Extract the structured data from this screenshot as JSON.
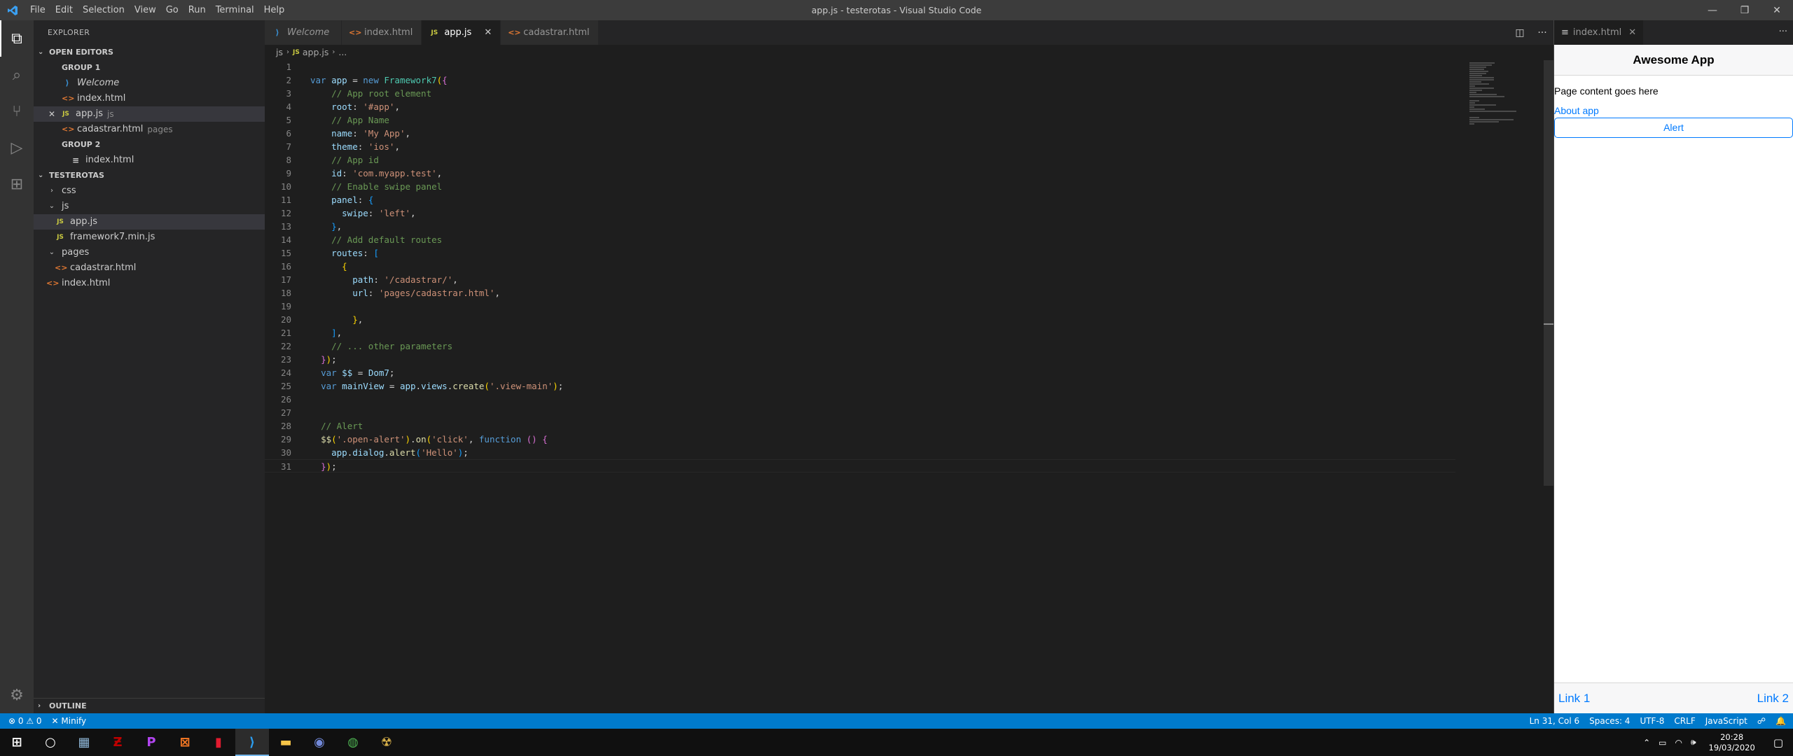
{
  "window": {
    "title": "app.js - testerotas - Visual Studio Code",
    "menu": [
      "File",
      "Edit",
      "Selection",
      "View",
      "Go",
      "Run",
      "Terminal",
      "Help"
    ],
    "controls": {
      "minimize": "—",
      "restore": "❐",
      "close": "✕"
    }
  },
  "activity_bar": {
    "items": [
      {
        "name": "explorer-icon",
        "glyph": "⧉"
      },
      {
        "name": "search-icon",
        "glyph": "⌕"
      },
      {
        "name": "source-control-icon",
        "glyph": "⑂"
      },
      {
        "name": "run-debug-icon",
        "glyph": "▷"
      },
      {
        "name": "extensions-icon",
        "glyph": "⊞"
      }
    ],
    "bottom": {
      "name": "manage-gear-icon",
      "glyph": "⚙"
    }
  },
  "sidebar": {
    "title": "EXPLORER",
    "open_editors": {
      "header": "OPEN EDITORS",
      "group1_label": "GROUP 1",
      "group1_items": [
        {
          "label": "Welcome",
          "icon": "vs",
          "icon_text": "⟩",
          "desc": "",
          "italic": true
        },
        {
          "label": "index.html",
          "icon": "html",
          "icon_text": "<>",
          "desc": ""
        },
        {
          "label": "app.js",
          "icon": "js",
          "icon_text": "JS",
          "desc": "js",
          "close": "✕"
        },
        {
          "label": "cadastrar.html",
          "icon": "html",
          "icon_text": "<>",
          "desc": "pages"
        }
      ],
      "group2_label": "GROUP 2",
      "group2_items": [
        {
          "label": "index.html",
          "icon": "preview",
          "icon_text": "≡",
          "desc": ""
        }
      ]
    },
    "project": {
      "header": "TESTEROTAS",
      "items": [
        {
          "label": "css",
          "type": "folder",
          "chev": "›",
          "depth": 1
        },
        {
          "label": "js",
          "type": "folder",
          "chev": "⌄",
          "depth": 1
        },
        {
          "label": "app.js",
          "type": "js",
          "depth": 2,
          "icon_text": "JS"
        },
        {
          "label": "framework7.min.js",
          "type": "js",
          "depth": 2,
          "icon_text": "JS"
        },
        {
          "label": "pages",
          "type": "folder",
          "chev": "⌄",
          "depth": 1
        },
        {
          "label": "cadastrar.html",
          "type": "html",
          "depth": 2,
          "icon_text": "<>"
        },
        {
          "label": "index.html",
          "type": "html",
          "depth": 1,
          "icon_text": "<>"
        }
      ]
    },
    "outline_header": "OUTLINE"
  },
  "editor": {
    "tabs": [
      {
        "label": "Welcome",
        "icon": "vs",
        "icon_text": "⟩",
        "italic": true,
        "active": false
      },
      {
        "label": "index.html",
        "icon": "html",
        "icon_text": "<>",
        "italic": false,
        "active": false
      },
      {
        "label": "app.js",
        "icon": "js",
        "icon_text": "JS",
        "italic": false,
        "active": true,
        "close": "✕"
      },
      {
        "label": "cadastrar.html",
        "icon": "html",
        "icon_text": "<>",
        "italic": false,
        "active": false
      }
    ],
    "tab_actions": {
      "split": "◫",
      "more": "···"
    },
    "breadcrumb": {
      "folder": "js",
      "file": "app.js",
      "symbol": "..."
    },
    "code_lines": [
      [],
      [
        [
          "kw",
          "var "
        ],
        [
          "var",
          "app"
        ],
        [
          "pl",
          " = "
        ],
        [
          "kw",
          "new "
        ],
        [
          "cls",
          "Framework7"
        ],
        [
          "br1",
          "("
        ],
        [
          "br2",
          "{"
        ]
      ],
      [
        [
          "pl",
          "    "
        ],
        [
          "com",
          "// App root element"
        ]
      ],
      [
        [
          "pl",
          "    "
        ],
        [
          "var",
          "root"
        ],
        [
          "pl",
          ": "
        ],
        [
          "str",
          "'#app'"
        ],
        [
          "pl",
          ","
        ]
      ],
      [
        [
          "pl",
          "    "
        ],
        [
          "com",
          "// App Name"
        ]
      ],
      [
        [
          "pl",
          "    "
        ],
        [
          "var",
          "name"
        ],
        [
          "pl",
          ": "
        ],
        [
          "str",
          "'My App'"
        ],
        [
          "pl",
          ","
        ]
      ],
      [
        [
          "pl",
          "    "
        ],
        [
          "var",
          "theme"
        ],
        [
          "pl",
          ": "
        ],
        [
          "str",
          "'ios'"
        ],
        [
          "pl",
          ","
        ]
      ],
      [
        [
          "pl",
          "    "
        ],
        [
          "com",
          "// App id"
        ]
      ],
      [
        [
          "pl",
          "    "
        ],
        [
          "var",
          "id"
        ],
        [
          "pl",
          ": "
        ],
        [
          "str",
          "'com.myapp.test'"
        ],
        [
          "pl",
          ","
        ]
      ],
      [
        [
          "pl",
          "    "
        ],
        [
          "com",
          "// Enable swipe panel"
        ]
      ],
      [
        [
          "pl",
          "    "
        ],
        [
          "var",
          "panel"
        ],
        [
          "pl",
          ": "
        ],
        [
          "br3",
          "{"
        ]
      ],
      [
        [
          "pl",
          "      "
        ],
        [
          "var",
          "swipe"
        ],
        [
          "pl",
          ": "
        ],
        [
          "str",
          "'left'"
        ],
        [
          "pl",
          ","
        ]
      ],
      [
        [
          "pl",
          "    "
        ],
        [
          "br3",
          "}"
        ],
        [
          "pl",
          ","
        ]
      ],
      [
        [
          "pl",
          "    "
        ],
        [
          "com",
          "// Add default routes"
        ]
      ],
      [
        [
          "pl",
          "    "
        ],
        [
          "var",
          "routes"
        ],
        [
          "pl",
          ": "
        ],
        [
          "br3",
          "["
        ]
      ],
      [
        [
          "pl",
          "      "
        ],
        [
          "br1",
          "{"
        ]
      ],
      [
        [
          "pl",
          "        "
        ],
        [
          "var",
          "path"
        ],
        [
          "pl",
          ": "
        ],
        [
          "str",
          "'/cadastrar/'"
        ],
        [
          "pl",
          ","
        ]
      ],
      [
        [
          "pl",
          "        "
        ],
        [
          "var",
          "url"
        ],
        [
          "pl",
          ": "
        ],
        [
          "str",
          "'pages/cadastrar.html'"
        ],
        [
          "pl",
          ","
        ]
      ],
      [],
      [
        [
          "pl",
          "        "
        ],
        [
          "br1",
          "}"
        ],
        [
          "pl",
          ","
        ]
      ],
      [
        [
          "pl",
          "    "
        ],
        [
          "br3",
          "]"
        ],
        [
          "pl",
          ","
        ]
      ],
      [
        [
          "pl",
          "    "
        ],
        [
          "com",
          "// ... other parameters"
        ]
      ],
      [
        [
          "pl",
          "  "
        ],
        [
          "br2",
          "}"
        ],
        [
          "br1",
          ")"
        ],
        [
          "pl",
          ";"
        ]
      ],
      [
        [
          "pl",
          "  "
        ],
        [
          "kw",
          "var "
        ],
        [
          "var",
          "$$"
        ],
        [
          "pl",
          " = "
        ],
        [
          "var",
          "Dom7"
        ],
        [
          "pl",
          ";"
        ]
      ],
      [
        [
          "pl",
          "  "
        ],
        [
          "kw",
          "var "
        ],
        [
          "var",
          "mainView"
        ],
        [
          "pl",
          " = "
        ],
        [
          "var",
          "app"
        ],
        [
          "pl",
          "."
        ],
        [
          "var",
          "views"
        ],
        [
          "pl",
          "."
        ],
        [
          "fn",
          "create"
        ],
        [
          "br1",
          "("
        ],
        [
          "str",
          "'.view-main'"
        ],
        [
          "br1",
          ")"
        ],
        [
          "pl",
          ";"
        ]
      ],
      [],
      [],
      [
        [
          "pl",
          "  "
        ],
        [
          "com",
          "// Alert"
        ]
      ],
      [
        [
          "pl",
          "  "
        ],
        [
          "fn",
          "$$"
        ],
        [
          "br1",
          "("
        ],
        [
          "str",
          "'.open-alert'"
        ],
        [
          "br1",
          ")"
        ],
        [
          "pl",
          "."
        ],
        [
          "fn",
          "on"
        ],
        [
          "br1",
          "("
        ],
        [
          "str",
          "'click'"
        ],
        [
          "pl",
          ", "
        ],
        [
          "kw",
          "function "
        ],
        [
          "br2",
          "()"
        ],
        [
          "pl",
          " "
        ],
        [
          "br2",
          "{"
        ]
      ],
      [
        [
          "pl",
          "    "
        ],
        [
          "var",
          "app"
        ],
        [
          "pl",
          "."
        ],
        [
          "var",
          "dialog"
        ],
        [
          "pl",
          "."
        ],
        [
          "fn",
          "alert"
        ],
        [
          "br3",
          "("
        ],
        [
          "str",
          "'Hello'"
        ],
        [
          "br3",
          ")"
        ],
        [
          "pl",
          ";"
        ]
      ],
      [
        [
          "pl",
          "  "
        ],
        [
          "br2",
          "}"
        ],
        [
          "br1",
          ")"
        ],
        [
          "pl",
          ";"
        ]
      ]
    ],
    "current_line": 31
  },
  "preview": {
    "tab": {
      "label": "index.html",
      "close": "✕"
    },
    "actions": {
      "more": "···"
    },
    "navbar_title": "Awesome App",
    "content_text": "Page content goes here",
    "link_about": "About app",
    "alert_button": "Alert",
    "toolbar": {
      "link1": "Link 1",
      "link2": "Link 2"
    }
  },
  "statusbar": {
    "problems": "⊗ 0 ⚠ 0",
    "minify": "✕ Minify",
    "position": "Ln 31, Col 6",
    "spaces": "Spaces: 4",
    "encoding": "UTF-8",
    "eol": "CRLF",
    "language": "JavaScript",
    "feedback": "☍",
    "bell": "🔔"
  },
  "taskbar": {
    "apps": [
      {
        "name": "windows-start-icon",
        "glyph": "⊞",
        "color": "#ffffff"
      },
      {
        "name": "cortana-search-icon",
        "glyph": "○",
        "color": "#ffffff"
      },
      {
        "name": "task-view-icon",
        "glyph": "▦",
        "color": "#8fb7d8"
      },
      {
        "name": "filezilla-icon",
        "glyph": "Ƶ",
        "color": "#bf0000"
      },
      {
        "name": "phpstorm-icon",
        "glyph": "P",
        "color": "#b345f1"
      },
      {
        "name": "xampp-icon",
        "glyph": "⊠",
        "color": "#fb7a24"
      },
      {
        "name": "media-app-icon",
        "glyph": "▮",
        "color": "#e21b2f"
      },
      {
        "name": "vscode-icon",
        "glyph": "⟩",
        "color": "#2b9ef0",
        "active": true
      },
      {
        "name": "file-explorer-icon",
        "glyph": "▬",
        "color": "#f6c548"
      },
      {
        "name": "discord-icon",
        "glyph": "◉",
        "color": "#7289da"
      },
      {
        "name": "chrome-icon",
        "glyph": "◍",
        "color": "#4caf50"
      },
      {
        "name": "game-app-icon",
        "glyph": "☢",
        "color": "#d8b14a"
      }
    ],
    "tray": {
      "chevron": "⌃",
      "network": "▭",
      "wifi": "◠",
      "volume": "🕪"
    },
    "time": "20:28",
    "date": "19/03/2020",
    "notifications": "▢"
  },
  "colors": {
    "accent": "#007acc",
    "link": "#007aff"
  }
}
